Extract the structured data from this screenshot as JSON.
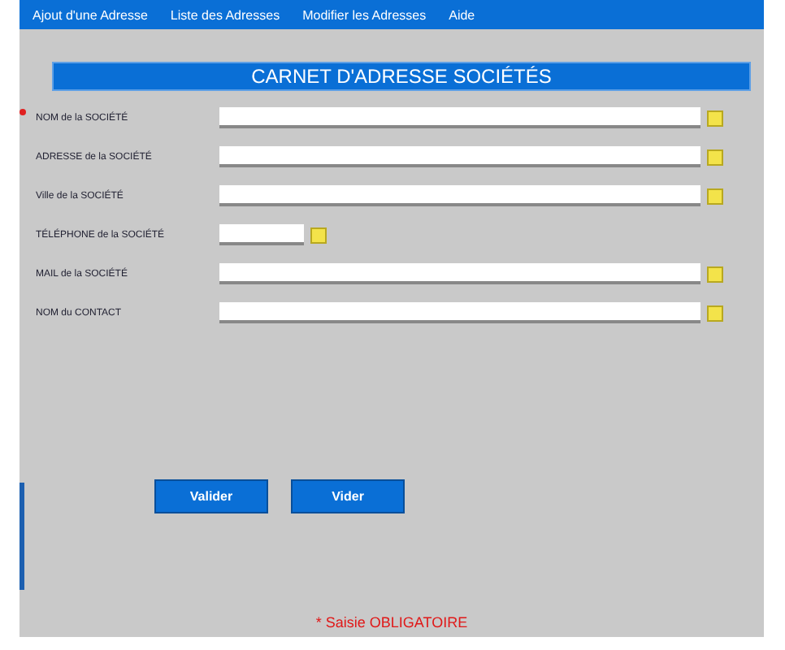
{
  "menu": [
    {
      "label": "Ajout d'une Adresse"
    },
    {
      "label": "Liste des Adresses"
    },
    {
      "label": "Modifier les Adresses"
    },
    {
      "label": "Aide"
    }
  ],
  "title": "CARNET D'ADRESSE SOCIÉTÉS",
  "fields": [
    {
      "label": "NOM de la SOCIÉTÉ",
      "required": true,
      "kind": "long"
    },
    {
      "label": "ADRESSE de la SOCIÉTÉ",
      "required": false,
      "kind": "long"
    },
    {
      "label": "Ville de la SOCIÉTÉ",
      "required": false,
      "kind": "long"
    },
    {
      "label": "TÉLÉPHONE de la SOCIÉTÉ",
      "required": false,
      "kind": "short"
    },
    {
      "label": "MAIL de la SOCIÉTÉ",
      "required": false,
      "kind": "long"
    },
    {
      "label": "NOM du CONTACT",
      "required": false,
      "kind": "long"
    }
  ],
  "buttons": [
    "Valider",
    "Vider"
  ],
  "footer": "* Saisie OBLIGATOIRE"
}
